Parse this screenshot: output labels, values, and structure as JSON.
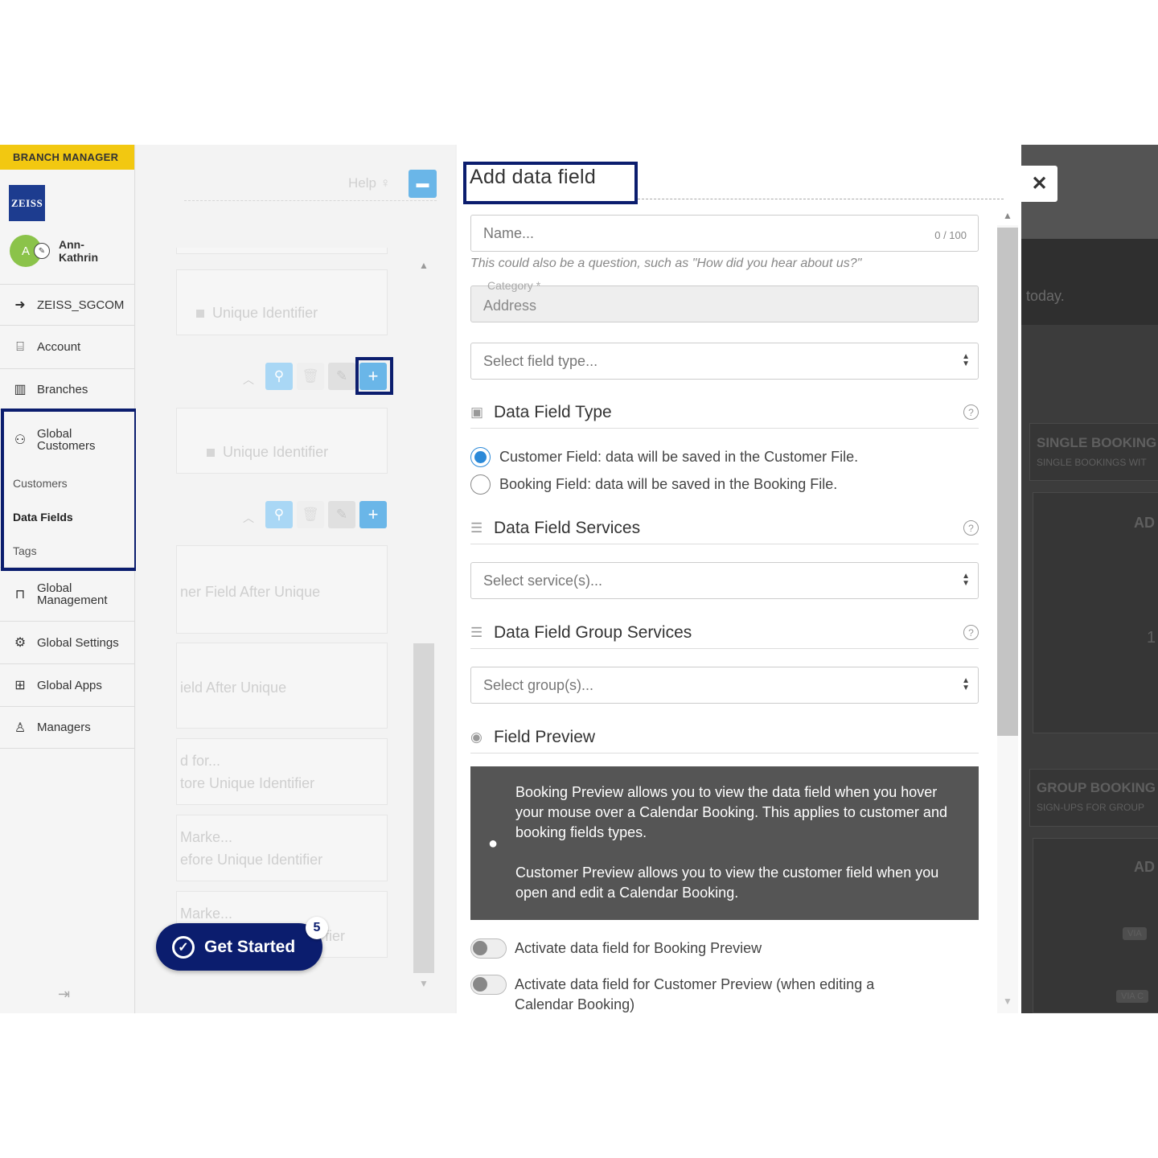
{
  "sidebar": {
    "role": "BRANCH MANAGER",
    "logo_text": "ZEISS",
    "user": {
      "initial": "A",
      "name": "Ann-Kathrin"
    },
    "items": [
      {
        "label": "ZEISS_SGCOM",
        "icon": "back-circle-icon"
      },
      {
        "label": "Account",
        "icon": "briefcase-icon"
      },
      {
        "label": "Branches",
        "icon": "building-icon"
      },
      {
        "label": "Global Customers",
        "icon": "users-icon"
      },
      {
        "label": "Global Management",
        "icon": "case-icon"
      },
      {
        "label": "Global Settings",
        "icon": "gears-icon"
      },
      {
        "label": "Global Apps",
        "icon": "grid-icon"
      },
      {
        "label": "Managers",
        "icon": "manager-icon"
      }
    ],
    "sub_items": [
      "Customers",
      "Data Fields",
      "Tags"
    ],
    "active_sub": "Data Fields"
  },
  "middle": {
    "help": "Help",
    "rows": [
      {
        "text": "Unique Identifier"
      },
      {
        "text": "Unique Identifier"
      },
      {
        "text": "ner Field   After   Unique"
      },
      {
        "text": "ield   After   Unique"
      },
      {
        "line1": "d for...",
        "line2": "tore   Unique Identifier"
      },
      {
        "line1": "Marke...",
        "line2": "efore   Unique Identifier"
      },
      {
        "line1": "Marke...",
        "line2": "fier"
      }
    ],
    "get_started": "Get Started",
    "get_started_badge": "5"
  },
  "panel": {
    "title": "Add data field",
    "name_placeholder": "Name...",
    "name_counter": "0 / 100",
    "name_hint": "This could also be a question, such as \"How did you hear about us?\"",
    "category_label": "Category *",
    "category_value": "Address",
    "field_type_placeholder": "Select field type...",
    "sections": {
      "type": "Data Field Type",
      "services": "Data Field Services",
      "group_services": "Data Field Group Services",
      "preview": "Field Preview"
    },
    "radio_customer": "Customer Field: data will be saved in the Customer File.",
    "radio_booking": "Booking Field: data will be saved in the Booking File.",
    "services_placeholder": "Select service(s)...",
    "groups_placeholder": "Select group(s)...",
    "info_p1": "Booking Preview allows you to view the data field when you hover your mouse over a Calendar Booking. This applies to customer and booking fields types.",
    "info_p2": "Customer Preview allows you to view the customer field when you open and edit a Calendar Booking.",
    "toggle_booking": "Activate data field for Booking Preview",
    "toggle_customer": "Activate data field for Customer Preview (when editing a Calendar Booking)"
  },
  "background": {
    "today": "today.",
    "single_booking": "SINGLE BOOKING S",
    "single_sub": "SINGLE BOOKINGS WIT",
    "group_booking": "GROUP BOOKING S",
    "group_sub": "SIGN-UPS FOR GROUP",
    "add1": "AD",
    "add2": "AD",
    "num": "1",
    "via1": "VIA",
    "via2": "VIA C"
  },
  "colors": {
    "accent": "#0b1d6e",
    "role_bar": "#f2c811",
    "radio": "#2b89d8",
    "info_bg": "#555555"
  }
}
